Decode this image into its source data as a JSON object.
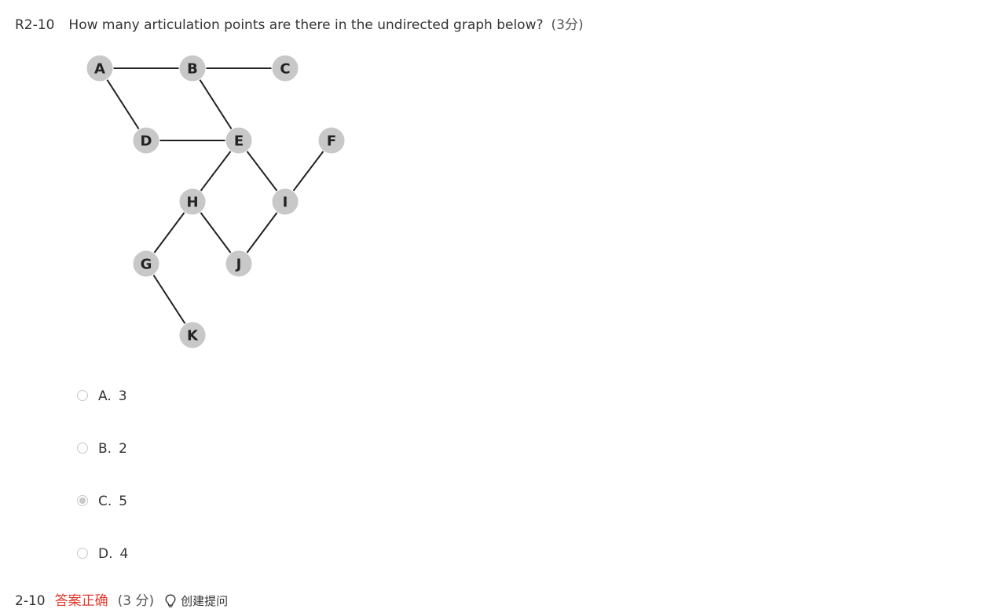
{
  "question": {
    "id": "R2-10",
    "text": "How many articulation points are there in the undirected graph below?",
    "score": "(3分)"
  },
  "graph": {
    "nodes": [
      {
        "label": "A"
      },
      {
        "label": "B"
      },
      {
        "label": "C"
      },
      {
        "label": "D"
      },
      {
        "label": "E"
      },
      {
        "label": "F"
      },
      {
        "label": "H"
      },
      {
        "label": "I"
      },
      {
        "label": "G"
      },
      {
        "label": "J"
      },
      {
        "label": "K"
      }
    ],
    "edges": [
      [
        "A",
        "B"
      ],
      [
        "B",
        "C"
      ],
      [
        "A",
        "D"
      ],
      [
        "B",
        "E"
      ],
      [
        "D",
        "E"
      ],
      [
        "E",
        "H"
      ],
      [
        "E",
        "I"
      ],
      [
        "I",
        "F"
      ],
      [
        "H",
        "G"
      ],
      [
        "H",
        "J"
      ],
      [
        "I",
        "J"
      ],
      [
        "G",
        "K"
      ]
    ],
    "node_color": "#c8c8c8",
    "edge_color": "#222222"
  },
  "options": [
    {
      "key": "A.",
      "value": "3",
      "selected": false
    },
    {
      "key": "B.",
      "value": "2",
      "selected": false
    },
    {
      "key": "C.",
      "value": "5",
      "selected": true
    },
    {
      "key": "D.",
      "value": "4",
      "selected": false
    }
  ],
  "footer": {
    "id": "2-10",
    "status": "答案正确",
    "score": "(3 分)",
    "ask_label": "创建提问",
    "ask_icon": "lightbulb-icon"
  },
  "colors": {
    "correct": "#e0372c",
    "text": "#333333",
    "radio": "#c8c8c8"
  }
}
